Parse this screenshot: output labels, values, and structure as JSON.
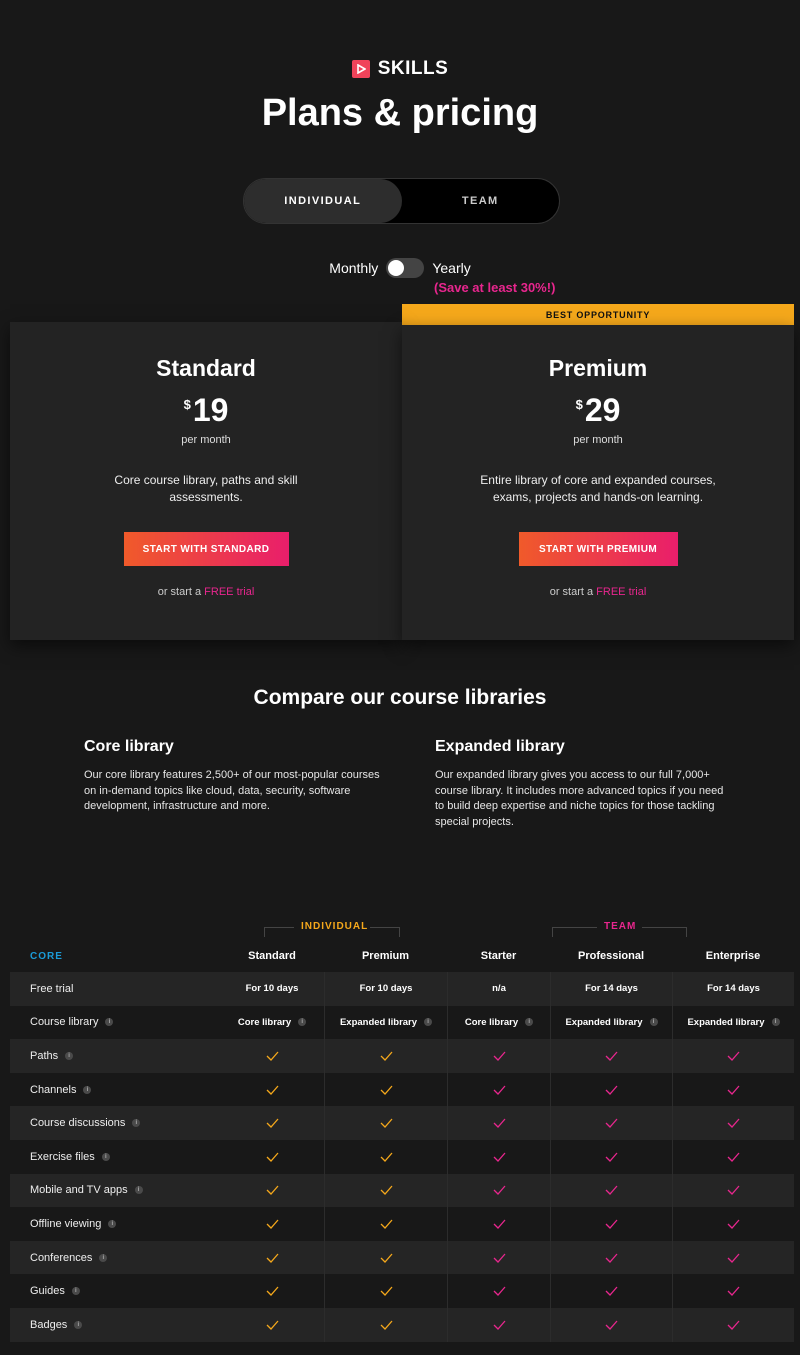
{
  "brand": {
    "name": "SKILLS",
    "accent": "#f0435a"
  },
  "page_title": "Plans & pricing",
  "audience_tabs": [
    {
      "label": "INDIVIDUAL",
      "active": true
    },
    {
      "label": "TEAM",
      "active": false
    }
  ],
  "billing": {
    "monthly_label": "Monthly",
    "yearly_label": "Yearly",
    "save_note": "(Save at least 30%!)",
    "yearly_selected": false
  },
  "best_banner": "BEST OPPORTUNITY",
  "plans": [
    {
      "name": "Standard",
      "currency": "$",
      "price": "19",
      "period": "per month",
      "description": "Core course library, paths and skill assessments.",
      "cta": "START WITH STANDARD",
      "trial_prefix": "or start a",
      "trial_link": "FREE trial"
    },
    {
      "name": "Premium",
      "currency": "$",
      "price": "29",
      "period": "per month",
      "description": "Entire library of core and expanded courses, exams, projects and hands-on learning.",
      "cta": "START WITH PREMIUM",
      "trial_prefix": "or start a",
      "trial_link": "FREE trial"
    }
  ],
  "compare": {
    "title": "Compare our course libraries",
    "core": {
      "title": "Core library",
      "text": "Our core library features 2,500+ of our most-popular courses on in-demand topics like cloud, data, security, software development, infrastructure and more."
    },
    "expanded": {
      "title": "Expanded library",
      "text": "Our expanded library gives you access to our full 7,000+ course library. It includes more advanced topics if you need to build deep expertise and niche topics for those tackling special projects."
    }
  },
  "table": {
    "group_individual": "INDIVIDUAL",
    "group_team": "TEAM",
    "section_label": "CORE",
    "columns": [
      "Standard",
      "Premium",
      "Starter",
      "Professional",
      "Enterprise"
    ],
    "colors": {
      "individual": "#f5a81b",
      "team": "#e8268e",
      "core": "#1b9bd7"
    },
    "rows": [
      {
        "label": "Free trial",
        "info": false,
        "cells": [
          "For 10 days",
          "For 10 days",
          "n/a",
          "For 14 days",
          "For 14 days"
        ]
      },
      {
        "label": "Course library",
        "info": true,
        "cells": [
          "Core library",
          "Expanded library",
          "Core library",
          "Expanded library",
          "Expanded library"
        ],
        "cell_info": true
      },
      {
        "label": "Paths",
        "info": true,
        "check": true
      },
      {
        "label": "Channels",
        "info": true,
        "check": true
      },
      {
        "label": "Course discussions",
        "info": true,
        "check": true
      },
      {
        "label": "Exercise files",
        "info": true,
        "check": true
      },
      {
        "label": "Mobile and TV apps",
        "info": true,
        "check": true
      },
      {
        "label": "Offline viewing",
        "info": true,
        "check": true
      },
      {
        "label": "Conferences",
        "info": true,
        "check": true
      },
      {
        "label": "Guides",
        "info": true,
        "check": true
      },
      {
        "label": "Badges",
        "info": true,
        "check": true
      }
    ]
  }
}
